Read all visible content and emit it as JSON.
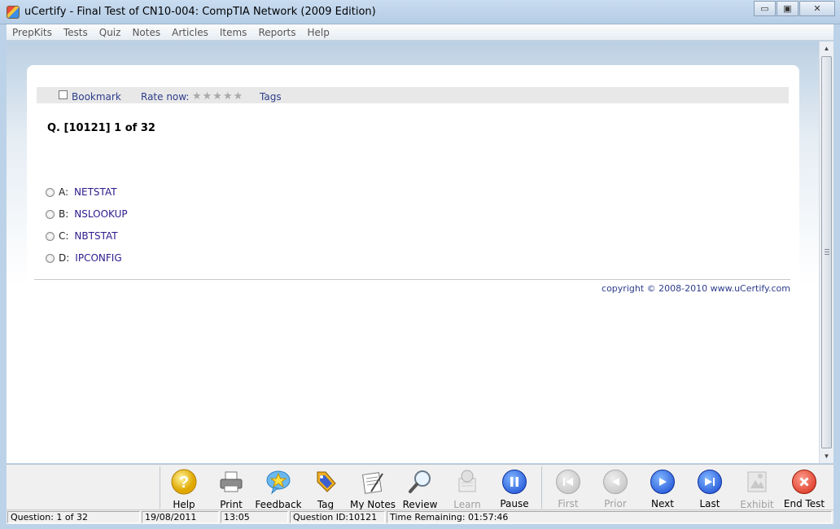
{
  "window": {
    "title": "uCertify - Final Test of  CN10-004: CompTIA Network  (2009 Edition)",
    "minimize_glyph": "▭",
    "maximize_glyph": "▣",
    "close_glyph": "✕"
  },
  "menu": [
    "PrepKits",
    "Tests",
    "Quiz",
    "Notes",
    "Articles",
    "Items",
    "Reports",
    "Help"
  ],
  "question_toolbar": {
    "bookmark": "Bookmark",
    "rate_now": "Rate now:",
    "stars": "★★★★★",
    "rating": 0,
    "tags": "Tags"
  },
  "question": {
    "title": "Q. [10121] 1 of 32",
    "options": [
      {
        "letter": "A:",
        "text": "NETSTAT"
      },
      {
        "letter": "B:",
        "text": "NSLOOKUP"
      },
      {
        "letter": "C:",
        "text": "NBTSTAT"
      },
      {
        "letter": "D:",
        "text": "IPCONFIG"
      }
    ]
  },
  "copyright": "copyright © 2008-2010 www.uCertify.com",
  "scrollbar": {
    "up_glyph": "▲",
    "down_glyph": "▼"
  },
  "buttons": {
    "help": "Help",
    "print": "Print",
    "feedback": "Feedback",
    "tag": "Tag",
    "my_notes": "My Notes",
    "review": "Review",
    "learn": "Learn",
    "pause": "Pause",
    "first": "First",
    "prior": "Prior",
    "next": "Next",
    "last": "Last",
    "exhibit": "Exhibit",
    "end_test": "End Test"
  },
  "status": {
    "question": "Question: 1 of 32",
    "date": "19/08/2011",
    "time": "13:05",
    "question_id": "Question ID:10121",
    "time_remaining": "Time Remaining: 01:57:46"
  }
}
